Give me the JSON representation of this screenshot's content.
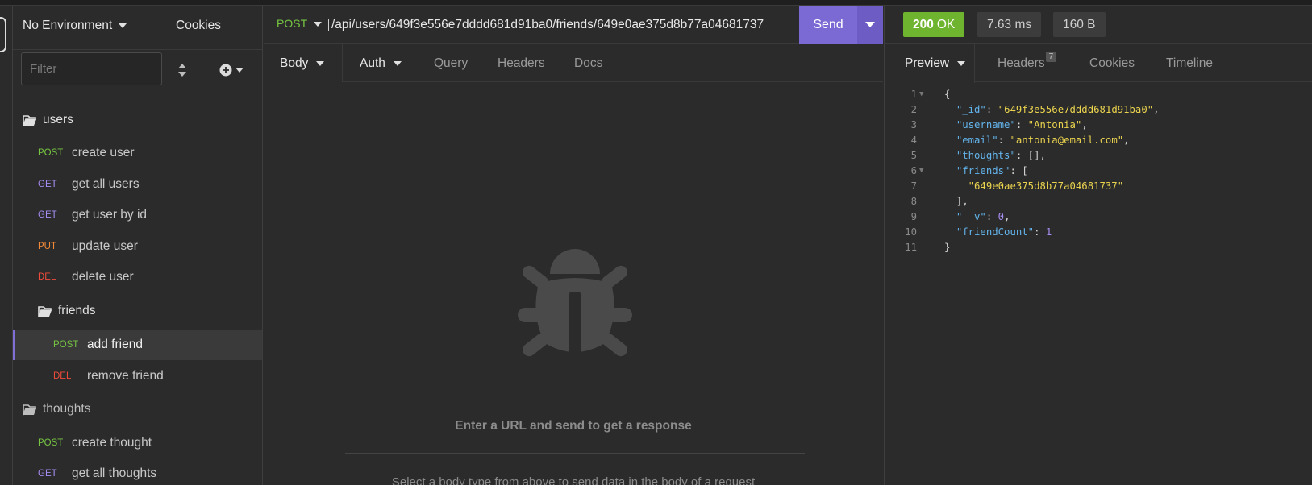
{
  "sidebar": {
    "environment": "No Environment",
    "cookies": "Cookies",
    "filter_placeholder": "Filter",
    "folders": {
      "users": "users",
      "friends": "friends",
      "thoughts": "thoughts"
    },
    "requests": [
      {
        "method": "POST",
        "name": "create user"
      },
      {
        "method": "GET",
        "name": "get all users"
      },
      {
        "method": "GET",
        "name": "get user by id"
      },
      {
        "method": "PUT",
        "name": "update user"
      },
      {
        "method": "DEL",
        "name": "delete user"
      },
      {
        "method": "POST",
        "name": "add friend"
      },
      {
        "method": "DEL",
        "name": "remove friend"
      },
      {
        "method": "POST",
        "name": "create thought"
      },
      {
        "method": "GET",
        "name": "get all thoughts"
      }
    ]
  },
  "request": {
    "method": "POST",
    "url": "/api/users/649f3e556e7dddd681d91ba0/friends/649e0ae375d8b77a04681737",
    "send_label": "Send",
    "tabs": [
      "Body",
      "Auth",
      "Query",
      "Headers",
      "Docs"
    ],
    "empty_title": "Enter a URL and send to get a response",
    "empty_sub": "Select a body type from above to send data in the body of a request"
  },
  "response": {
    "status_code": "200",
    "status_text": "OK",
    "time": "7.63 ms",
    "size": "160 B",
    "tabs": [
      "Preview",
      "Headers",
      "Cookies",
      "Timeline"
    ],
    "headers_count": "7",
    "line_numbers": [
      "1",
      "2",
      "3",
      "4",
      "5",
      "6",
      "7",
      "8",
      "9",
      "10",
      "11"
    ],
    "json": {
      "_id": "649f3e556e7dddd681d91ba0",
      "username": "Antonia",
      "email": "antonia@email.com",
      "friends_0": "649e0ae375d8b77a04681737",
      "__v": "0",
      "friendCount": "1"
    }
  },
  "colors": {
    "accent": "#7b6ad3",
    "status_ok": "#6fb42f",
    "post": "#76c442",
    "get": "#a58cf0",
    "put": "#f08a3a",
    "del": "#ee4b3b"
  }
}
